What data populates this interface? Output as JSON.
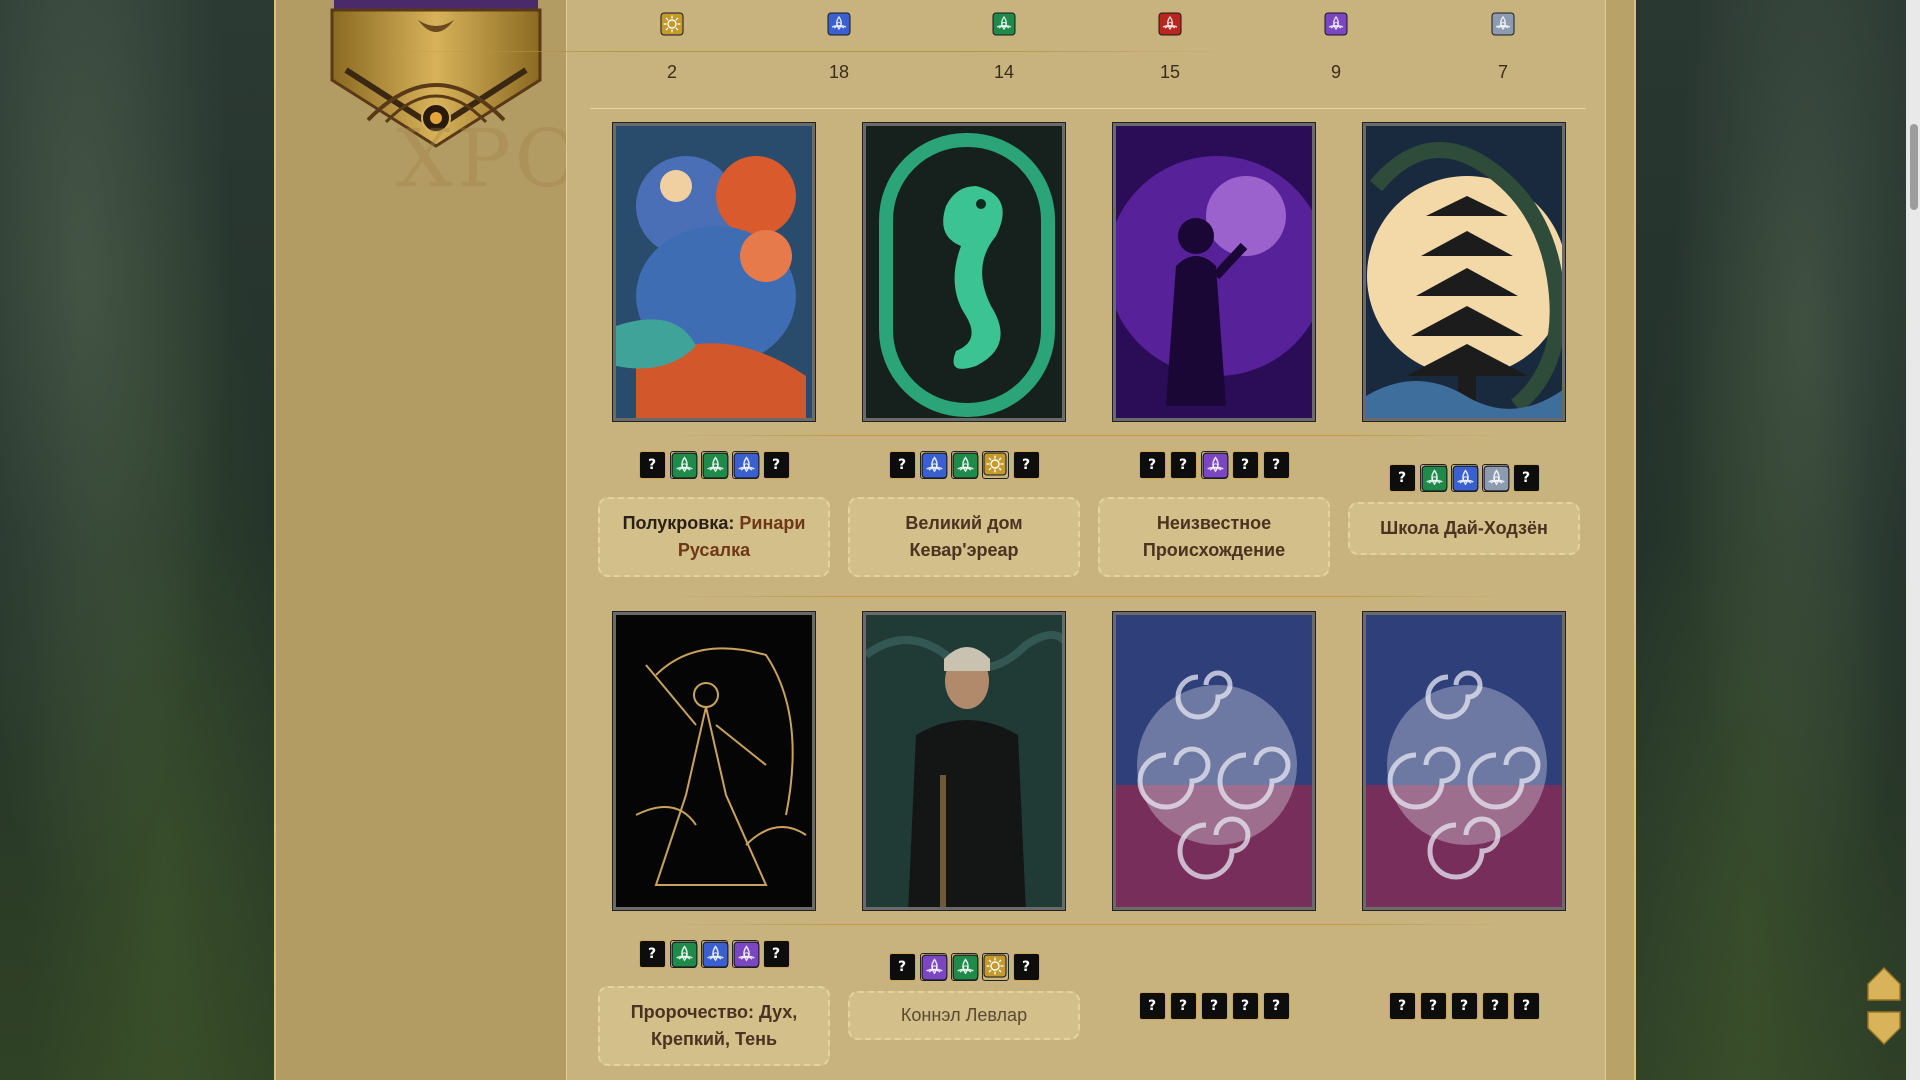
{
  "background_text": "ХРО",
  "colors": {
    "page": "#c8b27d",
    "gold": "#c49a45",
    "accent_text": "#6e3818",
    "gem_yellow": "#c49a2c",
    "gem_blue": "#3a5fd0",
    "gem_green": "#1f8a4a",
    "gem_red": "#b8261f",
    "gem_purple": "#7a46c2",
    "gem_gray": "#8c9bb0"
  },
  "stats": [
    {
      "icon": "sun-gem-icon",
      "color": "yellow",
      "value": "2"
    },
    {
      "icon": "triquetra-blue-icon",
      "color": "blue",
      "value": "18"
    },
    {
      "icon": "triquetra-green-icon",
      "color": "green",
      "value": "14"
    },
    {
      "icon": "triquetra-red-icon",
      "color": "red",
      "value": "15"
    },
    {
      "icon": "triquetra-purple-icon",
      "color": "purple",
      "value": "9"
    },
    {
      "icon": "triquetra-gray-icon",
      "color": "gray",
      "value": "7"
    }
  ],
  "cards": [
    {
      "art": "mermaid-couple-art",
      "badges": [
        "?",
        "green",
        "green",
        "blue",
        "?"
      ],
      "label_bold": "Полукровка:",
      "label_rest": " Ринари Русалка"
    },
    {
      "art": "jade-seahorse-art",
      "badges": [
        "?",
        "blue",
        "green",
        "yellow",
        "?"
      ],
      "label_bold": "",
      "label_rest": "Великий дом Кевар'эреар"
    },
    {
      "art": "violet-child-art",
      "badges": [
        "?",
        "?",
        "purple",
        "?",
        "?"
      ],
      "label_bold": "",
      "label_rest": "Неизвестное Происхождение"
    },
    {
      "art": "pagoda-serpent-art",
      "badges": [
        "?",
        "green",
        "blue",
        "gray",
        "?"
      ],
      "label_bold": "",
      "label_rest": "Школа Дай-Ходзён"
    },
    {
      "art": "golden-dancer-art",
      "badges": [
        "?",
        "green",
        "blue",
        "purple",
        "?"
      ],
      "label_bold": "",
      "label_rest": "Пророчество: Дух, Крепкий, Тень"
    },
    {
      "art": "elf-noble-art",
      "badges": [
        "?",
        "purple",
        "green",
        "yellow",
        "?"
      ],
      "label_bold": "",
      "label_rest": "Коннэл Левлар"
    },
    {
      "art": "cosmic-spiral-art",
      "badges": [
        "?",
        "?",
        "?",
        "?",
        "?"
      ],
      "label_bold": "",
      "label_rest": ""
    },
    {
      "art": "cosmic-spiral-art",
      "badges": [
        "?",
        "?",
        "?",
        "?",
        "?"
      ],
      "label_bold": "",
      "label_rest": ""
    }
  ]
}
